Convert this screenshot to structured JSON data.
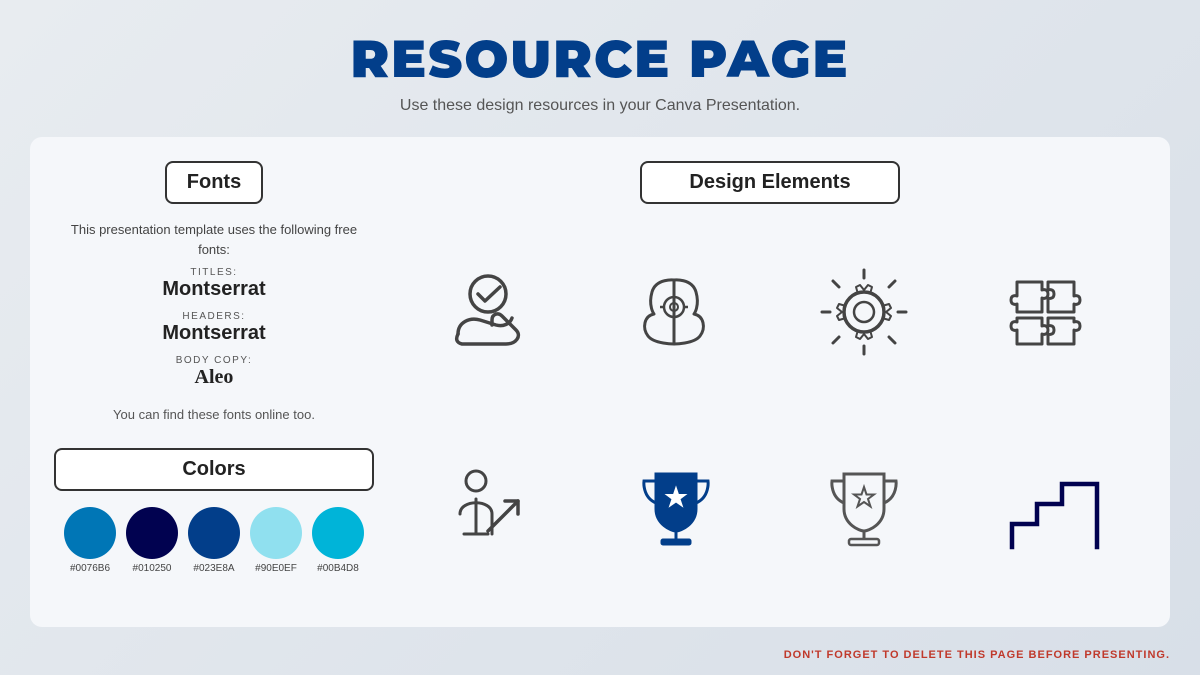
{
  "header": {
    "title": "RESOURCE PAGE",
    "subtitle": "Use these design resources in your Canva Presentation."
  },
  "left": {
    "fonts_label": "Fonts",
    "fonts_desc": "This presentation template uses the following free fonts:",
    "fonts": [
      {
        "label": "TITLES:",
        "name": "Montserrat",
        "style": "sans"
      },
      {
        "label": "HEADERS:",
        "name": "Montserrat",
        "style": "sans"
      },
      {
        "label": "BODY COPY:",
        "name": "Aleo",
        "style": "serif"
      }
    ],
    "fonts_note": "You can find these fonts online too.",
    "colors_label": "Colors",
    "colors": [
      {
        "hex": "#0076B6",
        "label": "#0076B6"
      },
      {
        "hex": "#010250",
        "label": "#010250"
      },
      {
        "hex": "#023E8A",
        "label": "#023E8A"
      },
      {
        "hex": "#90E0EF",
        "label": "#90E0EF"
      },
      {
        "hex": "#00B4D8",
        "label": "#00B4D8"
      }
    ]
  },
  "right": {
    "label": "Design Elements"
  },
  "footer": {
    "note": "DON'T FORGET TO DELETE THIS PAGE BEFORE PRESENTING."
  }
}
